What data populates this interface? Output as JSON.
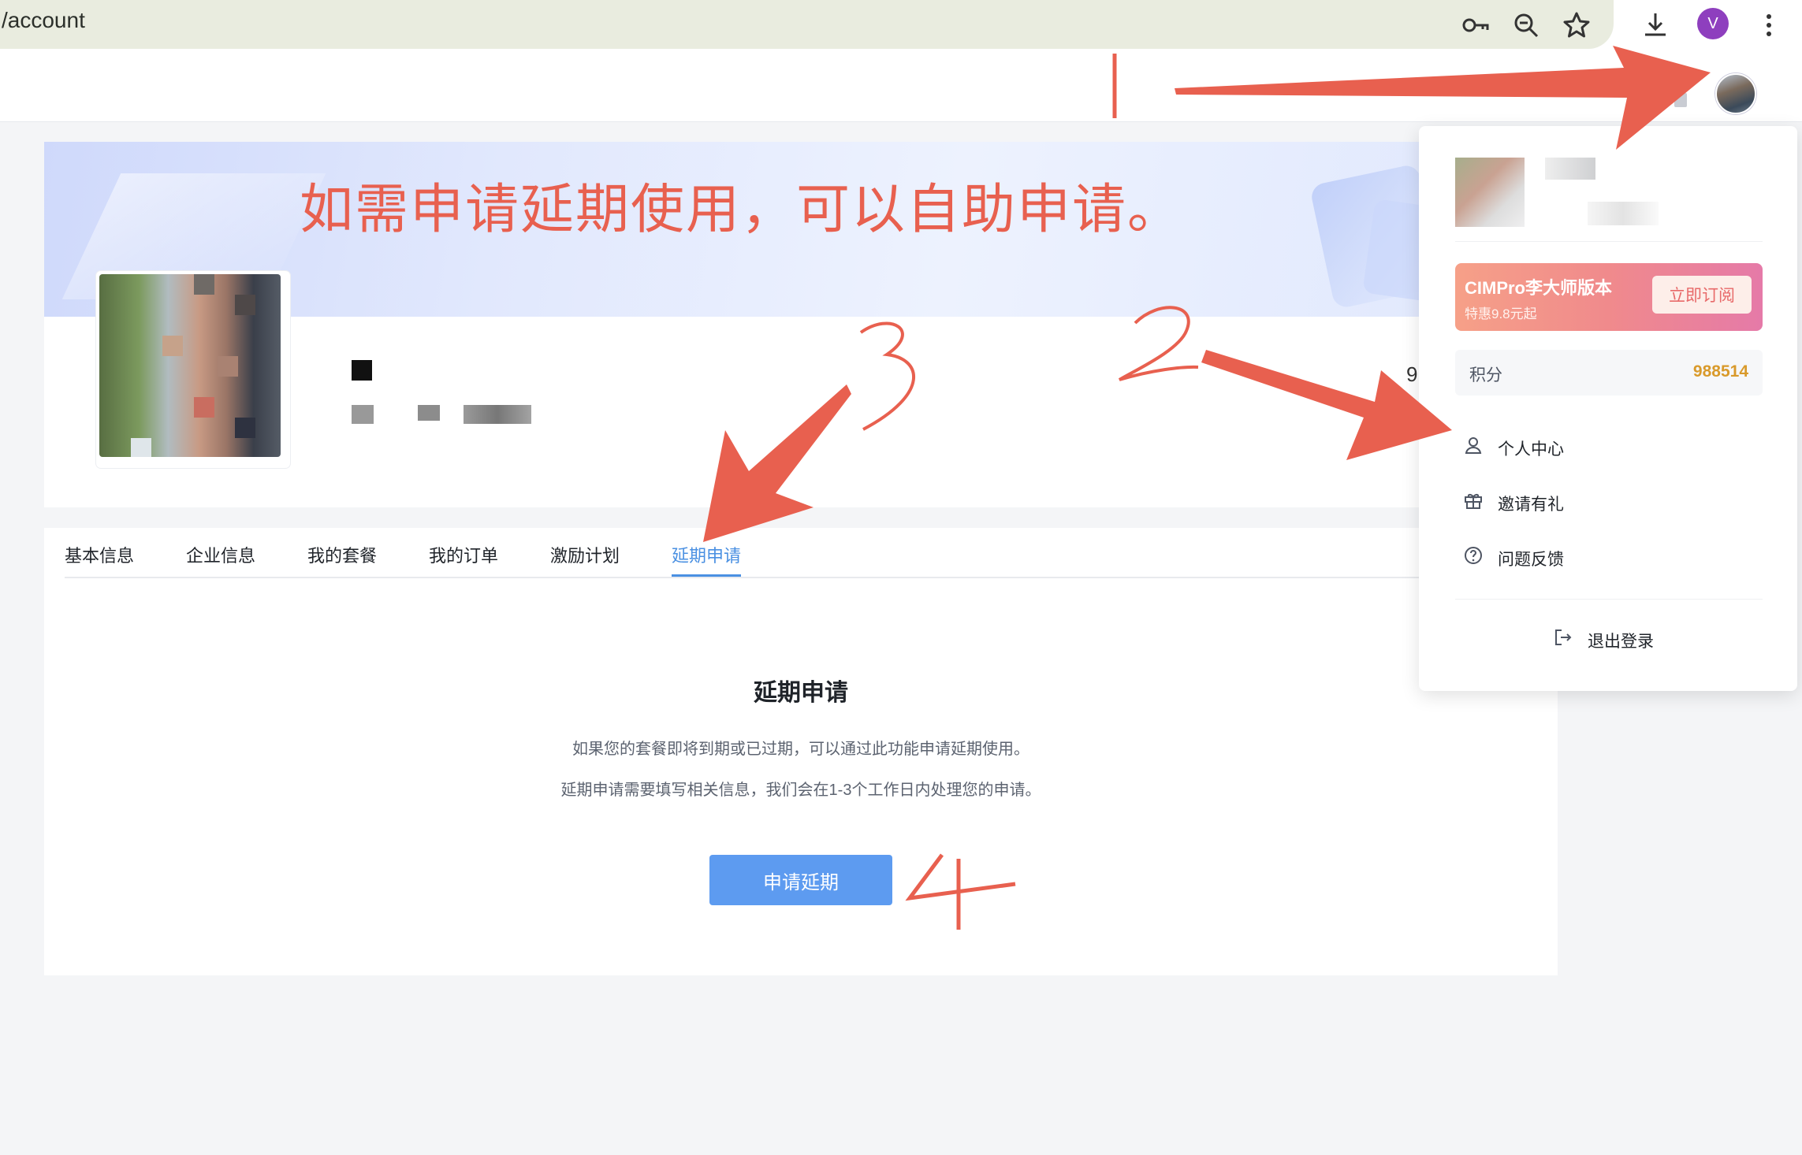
{
  "browser": {
    "url": "/account",
    "profile_initial": "V",
    "icons": [
      "key-icon",
      "zoom-icon",
      "star-icon",
      "download-icon",
      "more-icon"
    ]
  },
  "profile": {
    "right_number": "9"
  },
  "tabs": [
    {
      "label": "基本信息"
    },
    {
      "label": "企业信息"
    },
    {
      "label": "我的套餐"
    },
    {
      "label": "我的订单"
    },
    {
      "label": "激励计划"
    },
    {
      "label": "延期申请",
      "active": true
    }
  ],
  "extension": {
    "title": "延期申请",
    "desc1": "如果您的套餐即将到期或已过期，可以通过此功能申请延期使用。",
    "desc2": "延期申请需要填写相关信息，我们会在1-3个工作日内处理您的申请。",
    "button": "申请延期"
  },
  "dropdown": {
    "promo": {
      "title": "CIMPro李大师版本",
      "subtitle": "特惠9.8元起",
      "button": "立即订阅"
    },
    "points": {
      "label": "积分",
      "value": "988514"
    },
    "menu": [
      {
        "label": "个人中心",
        "icon": "user-icon"
      },
      {
        "label": "邀请有礼",
        "icon": "gift-icon"
      },
      {
        "label": "问题反馈",
        "icon": "help-icon"
      }
    ],
    "logout": "退出登录"
  },
  "annotations": {
    "headline": "如需申请延期使用，可以自助申请。",
    "steps": [
      "1",
      "2",
      "3",
      "4"
    ]
  },
  "colors": {
    "accent": "#4a90e2",
    "button": "#5d9bf0",
    "annotation": "#e8604f",
    "points": "#d99a2b"
  }
}
